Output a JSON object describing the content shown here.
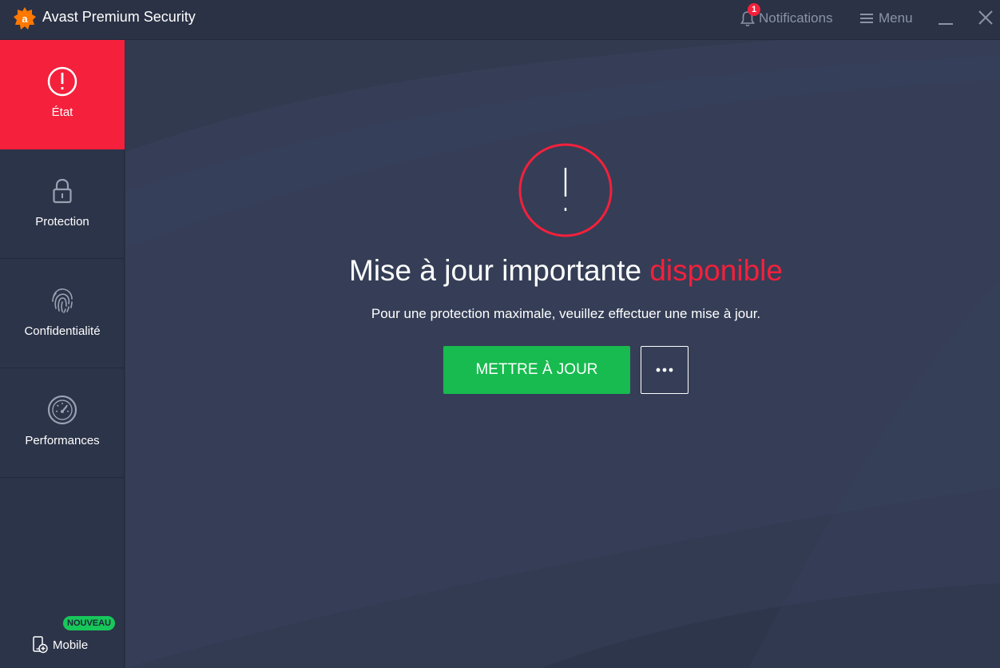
{
  "app": {
    "title": "Avast Premium Security",
    "logo_icon": "avast-logo-icon",
    "brand_color": "#ff7800"
  },
  "header": {
    "notifications_label": "Notifications",
    "notifications_count": "1",
    "menu_label": "Menu"
  },
  "sidebar": {
    "items": [
      {
        "label": "État",
        "icon": "alert-circle-icon",
        "active": true
      },
      {
        "label": "Protection",
        "icon": "lock-icon",
        "active": false
      },
      {
        "label": "Confidentialité",
        "icon": "fingerprint-icon",
        "active": false
      },
      {
        "label": "Performances",
        "icon": "speedometer-icon",
        "active": false
      }
    ],
    "mobile_label": "Mobile",
    "mobile_badge": "NOUVEAU"
  },
  "main": {
    "headline_part1": "Mise à jour importante ",
    "headline_part2": "disponible",
    "subtitle": "Pour une protection maximale, veuillez effectuer une mise à jour.",
    "update_button": "METTRE À JOUR",
    "more_icon": "more-dots-icon"
  },
  "colors": {
    "alert_red": "#f4203c",
    "success_green": "#17bb4f",
    "background": "#353e56",
    "sidebar": "#2c3449"
  }
}
